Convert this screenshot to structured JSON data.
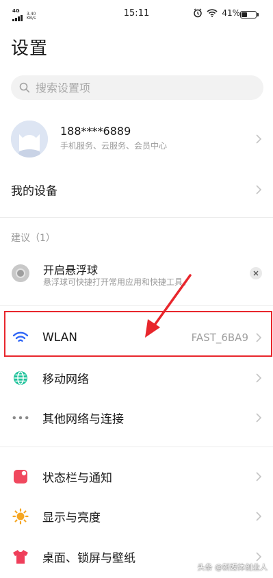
{
  "status_bar": {
    "network": "4G",
    "speed": "3.40\nKB/s",
    "time": "15:11",
    "battery": "41%",
    "battery_level": 0.41
  },
  "page": {
    "title": "设置"
  },
  "search": {
    "placeholder": "搜索设置项"
  },
  "account": {
    "name": "188****6889",
    "subtitle": "手机服务、云服务、会员中心"
  },
  "my_device": {
    "label": "我的设备"
  },
  "suggestions": {
    "header": "建议（1）",
    "item": {
      "title": "开启悬浮球",
      "description": "悬浮球可快捷打开常用应用和快捷工具。"
    }
  },
  "settings": [
    {
      "label": "WLAN",
      "value": "FAST_6BA9",
      "icon": "wifi-icon"
    },
    {
      "label": "移动网络",
      "icon": "globe-icon"
    },
    {
      "label": "其他网络与连接",
      "icon": "more-dots-icon"
    },
    {
      "label": "状态栏与通知",
      "icon": "notification-icon"
    },
    {
      "label": "显示与亮度",
      "icon": "sun-icon"
    },
    {
      "label": "桌面、锁屏与壁纸",
      "icon": "shirt-icon"
    }
  ],
  "watermark": "头条 @新媒体创业人",
  "colors": {
    "wifi": "#2f66f6",
    "globe": "#1ec29a",
    "notification": "#f0485e",
    "sun": "#f5a623",
    "shirt": "#ef3e5a",
    "highlight": "#e8262c"
  }
}
